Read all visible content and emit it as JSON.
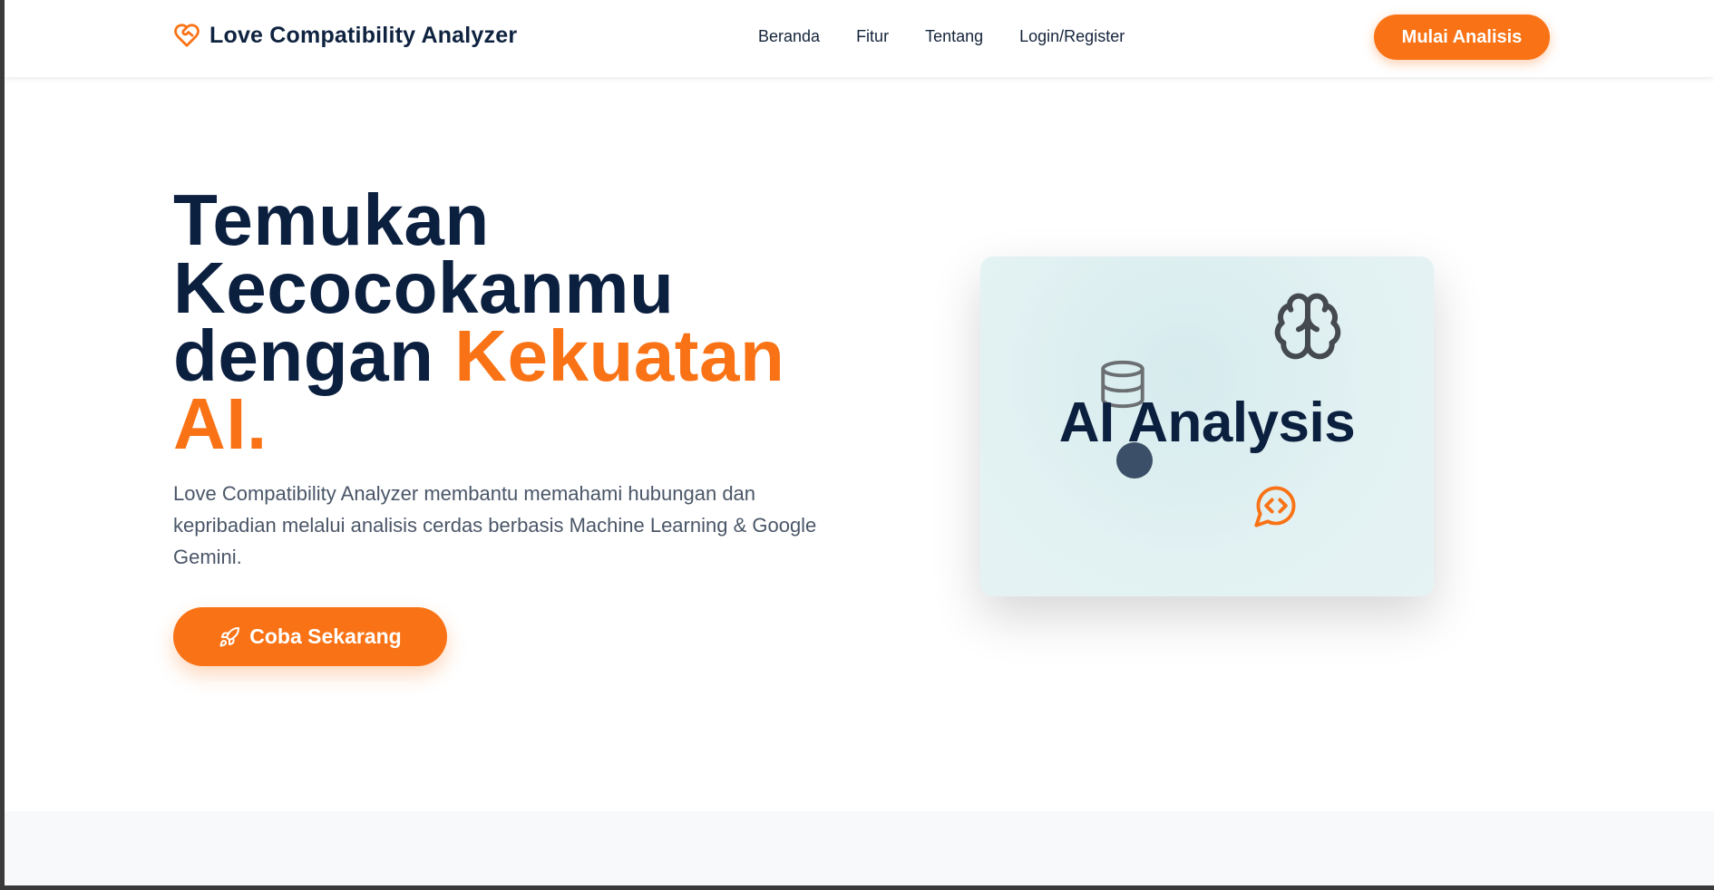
{
  "navbar": {
    "brand": "Love Compatibility Analyzer",
    "brand_icon": "heart-handshake-icon",
    "links": [
      "Beranda",
      "Fitur",
      "Tentang",
      "Login/Register"
    ],
    "cta": "Mulai Analisis"
  },
  "hero": {
    "title_line1": "Temukan",
    "title_line2": "Kecocokanmu",
    "title_line3_start": "dengan",
    "title_line3_accent": "Kekuatan",
    "title_line4_accent": "AI.",
    "description": "Love Compatibility Analyzer membantu memahami hubungan dan kepribadian melalui analisis cerdas berbasis Machine Learning & Google Gemini.",
    "cta": "Coba Sekarang",
    "cta_icon": "rocket-icon"
  },
  "illustration": {
    "title": "AI Analysis",
    "icons": [
      "brain-icon",
      "database-icon",
      "code-chat-icon"
    ]
  },
  "colors": {
    "accent": "#f97316",
    "navy": "#0b1f3f",
    "card_bg": "#e2f1f2"
  }
}
